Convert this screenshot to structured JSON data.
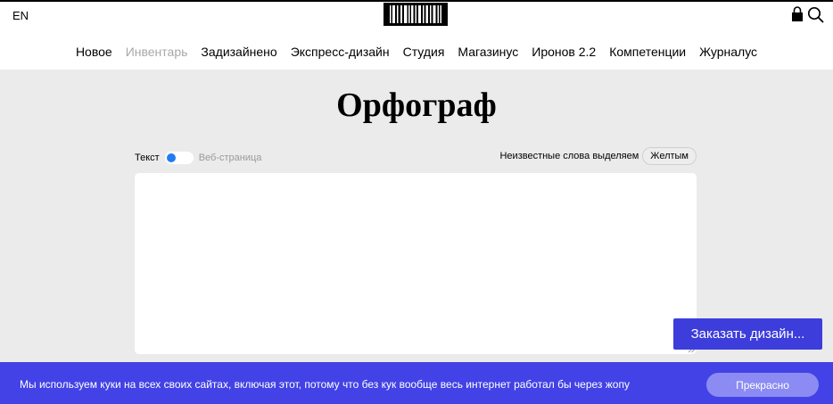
{
  "header": {
    "language": "EN",
    "nav": [
      {
        "label": "Новое"
      },
      {
        "label": "Инвентарь"
      },
      {
        "label": "Задизайнено"
      },
      {
        "label": "Экспресс-дизайн"
      },
      {
        "label": "Студия"
      },
      {
        "label": "Магазинус"
      },
      {
        "label": "Иронов 2.2"
      },
      {
        "label": "Компетенции"
      },
      {
        "label": "Журналус"
      }
    ]
  },
  "main": {
    "title": "Орфограф",
    "mode": {
      "text_label": "Текст",
      "web_label": "Веб-страница"
    },
    "highlight": {
      "label": "Неизвестные слова выделяем",
      "value": "Желтым"
    },
    "editor_value": ""
  },
  "order_button": "Заказать дизайн...",
  "cookie": {
    "text": "Мы используем куки на всех своих сайтах, включая этот, потому что без кук вообще весь интернет работал бы через жопу",
    "button": "Прекрасно"
  },
  "colors": {
    "accent": "#4242e6",
    "toggle": "#1f7cf2",
    "muted_nav": "#a8a8a8"
  },
  "icons": [
    "barcode-logo",
    "lock-icon",
    "search-icon"
  ]
}
